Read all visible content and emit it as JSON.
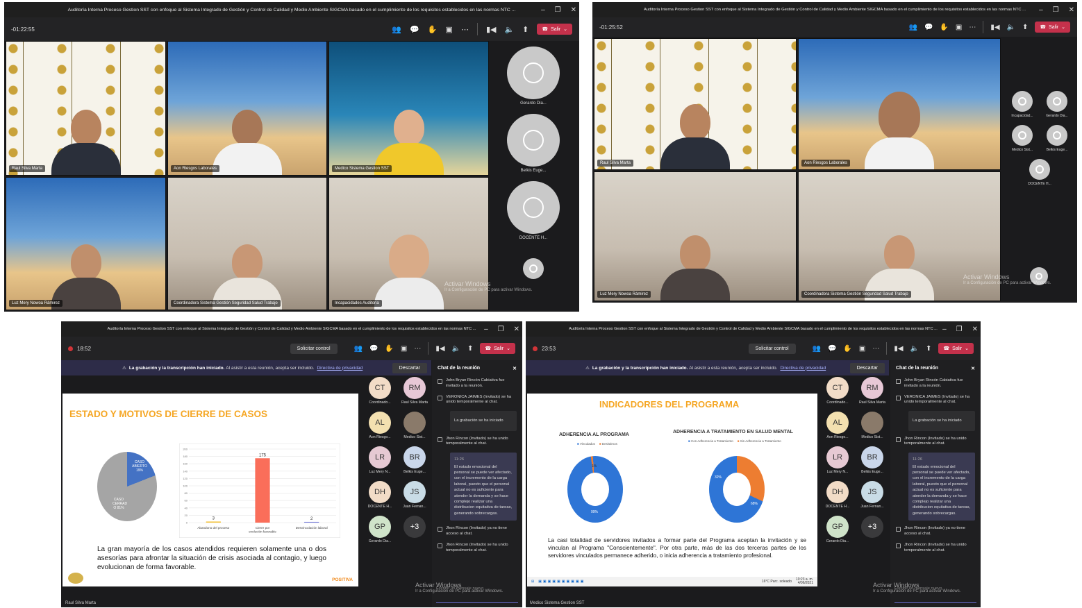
{
  "meeting_title": "Auditoría Interna Proceso Gestion SST con enfoque al Sistema Integrado de Gestión y Control de Calidad y Medio Ambiente SIGCMA basado en el cumplimiento de los requisitos establecidos en las normas NTC ...",
  "leave_label": "Salir",
  "request_control_label": "Solicitar control",
  "activate_windows": {
    "title": "Activar Windows",
    "sub": "Ir a Configuración de PC para activar Windows."
  },
  "panel1": {
    "timer": "-01:22:55",
    "tiles": [
      {
        "name": "Raul Silva Marta"
      },
      {
        "name": "Aon Riesgos Laborales"
      },
      {
        "name": "Medico Sistema Gestion SST"
      },
      {
        "name": "Luz Mery Nowoa Rámirez"
      },
      {
        "name": "Coordinadora Sistema Gestión Seguridad Salud Trabajo"
      },
      {
        "name": "Incapacidades Auditoria"
      }
    ],
    "side": [
      "Gerardo Dia...",
      "Belkis Euge...",
      "DOCENTE H..."
    ]
  },
  "panel2": {
    "timer": "-01:25:52",
    "tiles": [
      {
        "name": "Raul Silva Marta"
      },
      {
        "name": "Aon Riesgos Laborales"
      },
      {
        "name": "Luz Mery Nowoa Rámirez"
      },
      {
        "name": "Coordinadora Sistema Gestión Seguridad Salud Trabajo"
      }
    ],
    "side": [
      "Incapacidad...",
      "Gerardo Dia...",
      "Medico Sist...",
      "Belkis Euge...",
      "DOCENTE H..."
    ]
  },
  "recbanner": {
    "bold": "La grabación y la transcripción han iniciado.",
    "text": "Al asistir a esta reunión, acepta ser incluido.",
    "link": "Directiva de privacidad",
    "dismiss": "Descartar"
  },
  "participants": [
    {
      "initials": "CT",
      "name": "Coordinado...",
      "color": "#f2dcc7"
    },
    {
      "initials": "RM",
      "name": "Raul Silva Marta",
      "color": "#e7c8d6"
    },
    {
      "initials": "AL",
      "name": "Aon Riesgo...",
      "color": "#f3e0b0"
    },
    {
      "initials": "",
      "name": "Medico Sist...",
      "color": "#8a7a6a"
    },
    {
      "initials": "LR",
      "name": "Luz Mery N...",
      "color": "#e6c9d3"
    },
    {
      "initials": "BR",
      "name": "Belkis Euge...",
      "color": "#c9d6ea"
    },
    {
      "initials": "DH",
      "name": "DOCENTE H...",
      "color": "#f2dcc7"
    },
    {
      "initials": "JS",
      "name": "Juan Fernan...",
      "color": "#c9dce6"
    },
    {
      "initials": "GP",
      "name": "Gerardo Dia...",
      "color": "#cfe3c9"
    },
    {
      "initials": "+3",
      "name": "",
      "color": "#3a3a3c"
    }
  ],
  "chat": {
    "title": "Chat de la reunión",
    "events": [
      "John Bryan Rincón Cabiativa fue invitado a la reunión.",
      "VERONICA JAIMES (Invitado) se ha unido temporalmente al chat."
    ],
    "recording_note": "La grabación se ha iniciado",
    "event3": "Jhon Rincon (Invitado) se ha unido temporalmente al chat.",
    "msg_time": "11:26",
    "msg": "El estado emocional del personal se puede ver afectado, con el incremento de la carga laboral, puesto que el personal actual no es suficiente para atender la demanda y se hace complejo realizar una distribucion equitativa de tareas, generando sobrecargas.",
    "event4": "Jhon Rincon (Invitado) ya no tiene acceso al chat.",
    "event5": "Jhon Rincon (Invitado) se ha unido temporalmente al chat.",
    "composer": "Escribir un mensaje nuevo"
  },
  "panel3": {
    "timer": "18:52",
    "presenter": "Raul Silva Marta",
    "slide_title": "ESTADO Y MOTIVOS DE CIERRE DE CASOS",
    "pie_labels": {
      "open": "CASO ABIERTO 19%",
      "closed": "CASO CERRAD O 81%"
    },
    "slide_text": "La gran mayoría de los casos atendidos requieren solamente una o dos asesorías para afrontar la situación de crisis asociada al contagio, y luego evolucionan de forma favorable.",
    "brand": "POSITIVA"
  },
  "panel4": {
    "timer": "23:53",
    "presenter": "Medico Sistema Gestion SST",
    "slide_title": "INDICADORES DEL PROGRAMA",
    "chart1_title": "ADHERENCIA AL PROGRAMA",
    "chart1_legend": [
      "Vinculados",
      "Desistimos"
    ],
    "chart1_labels": [
      "1%",
      "99%"
    ],
    "chart2_title": "ADHERENCIA A TRATAMIENTO EN SALUD MENTAL",
    "chart2_legend": [
      "Con Adherencia a Tratamiento",
      "Sin Adherencia a Tratamiento"
    ],
    "chart2_labels": [
      "32%",
      "68%"
    ],
    "slide_text": "La casi totalidad de servidores invitados a formar parte del Programa aceptan la invitación y se vinculan al Programa \"Conscientemente\". Por otra parte, más de las dos terceras partes de los servidores vinculados permanece adherido, o inicia adherencia a tratamiento profesional.",
    "taskbar_weather": "16°C Parc. soleado",
    "taskbar_time": "10:23 a. m.",
    "taskbar_date": "4/06/2021"
  },
  "chart_data": [
    {
      "type": "bar",
      "categories": [
        "Abandono del proceso",
        "Cierre por evolución favorable",
        "Desvinculación laboral"
      ],
      "values": [
        3,
        175,
        2
      ],
      "ylim": [
        0,
        200
      ],
      "yticks": [
        0,
        20,
        40,
        60,
        80,
        100,
        120,
        140,
        160,
        180,
        200
      ],
      "colors": [
        "#f4c542",
        "#fa6e5a",
        "#7a7fd8"
      ]
    },
    {
      "type": "pie",
      "labels": [
        "CASO ABIERTO",
        "CASO CERRADO"
      ],
      "values": [
        19,
        81
      ],
      "colors": [
        "#4472c4",
        "#a5a5a5"
      ]
    },
    {
      "type": "pie",
      "labels": [
        "Vinculados",
        "Desistimos"
      ],
      "values": [
        99,
        1
      ],
      "colors": [
        "#2e75d6",
        "#ed7d31"
      ]
    },
    {
      "type": "pie",
      "labels": [
        "Con Adherencia a Tratamiento",
        "Sin Adherencia a Tratamiento"
      ],
      "values": [
        68,
        32
      ],
      "colors": [
        "#2e75d6",
        "#ed7d31"
      ]
    }
  ]
}
